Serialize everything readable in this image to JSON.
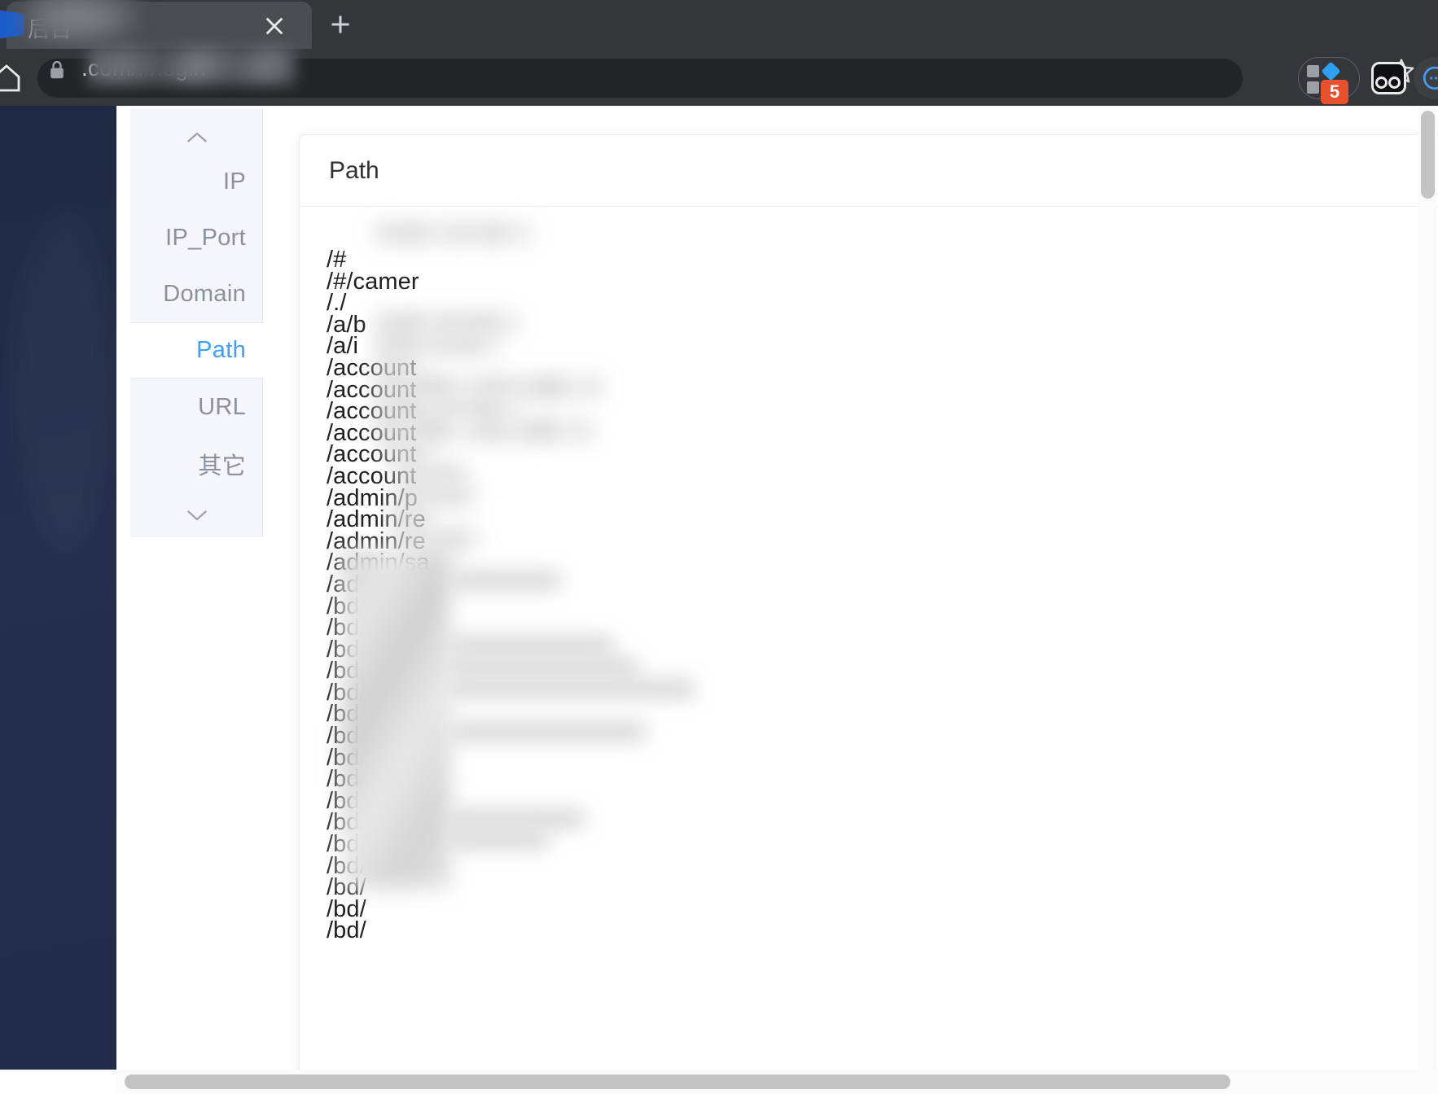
{
  "browser": {
    "tab": {
      "title_visible": "后台",
      "title_redacted": true,
      "favicon": "blue-document-favicon",
      "close_label": "×",
      "new_tab_label": "+"
    },
    "toolbar": {
      "home_icon": "home-icon",
      "lock_icon": "lock-icon",
      "url_host_visible": ".com",
      "url_path": "/#/login",
      "url_prefix_redacted": true,
      "star_icon": "bookmark-star-icon",
      "extensions_icon": "puzzle-extensions-icon",
      "extensions_badge": "5",
      "glasses_icon": "glasses-extension-icon",
      "avatar_icon": "chat-bubble-avatar-icon"
    }
  },
  "page": {
    "sidebar": {
      "collapsed": true
    },
    "tab_rail": {
      "scroll_up_icon": "chevron-up-icon",
      "scroll_down_icon": "chevron-down-icon",
      "active": "Path",
      "items": [
        {
          "label": "IP",
          "active": false
        },
        {
          "label": "IP_Port",
          "active": false
        },
        {
          "label": "Domain",
          "active": false
        },
        {
          "label": "Path",
          "active": true
        },
        {
          "label": "URL",
          "active": false
        },
        {
          "label": "其它",
          "active": false
        }
      ]
    },
    "card": {
      "title": "Path",
      "paths": [
        "/#",
        "/#/camer",
        "/./",
        "/a/b",
        "/a/i",
        "/account",
        "/account",
        "/account",
        "/account",
        "/account",
        "/account",
        "/admin/p",
        "/admin/re",
        "/admin/re",
        "/admin/sa",
        "/admin/u",
        "/bd/",
        "/bd/",
        "/bd/",
        "/bd/",
        "/bd/",
        "/bd/",
        "/bd/",
        "/bd/",
        "/bd/",
        "/bd/",
        "/bd/",
        "/bd/",
        "/bd/",
        "/bd/",
        "/bd/",
        "/bd/"
      ]
    },
    "scrollbars": {
      "vertical_icon": "vertical-scrollbar",
      "horizontal_icon": "horizontal-scrollbar"
    }
  },
  "colors": {
    "accent_blue": "#409eff",
    "chrome_bg": "#35363a",
    "omnibox_bg": "#232427",
    "badge_red": "#e8502e",
    "app_sidebar": "#232f4b",
    "rail_bg": "#f4f6fb"
  }
}
